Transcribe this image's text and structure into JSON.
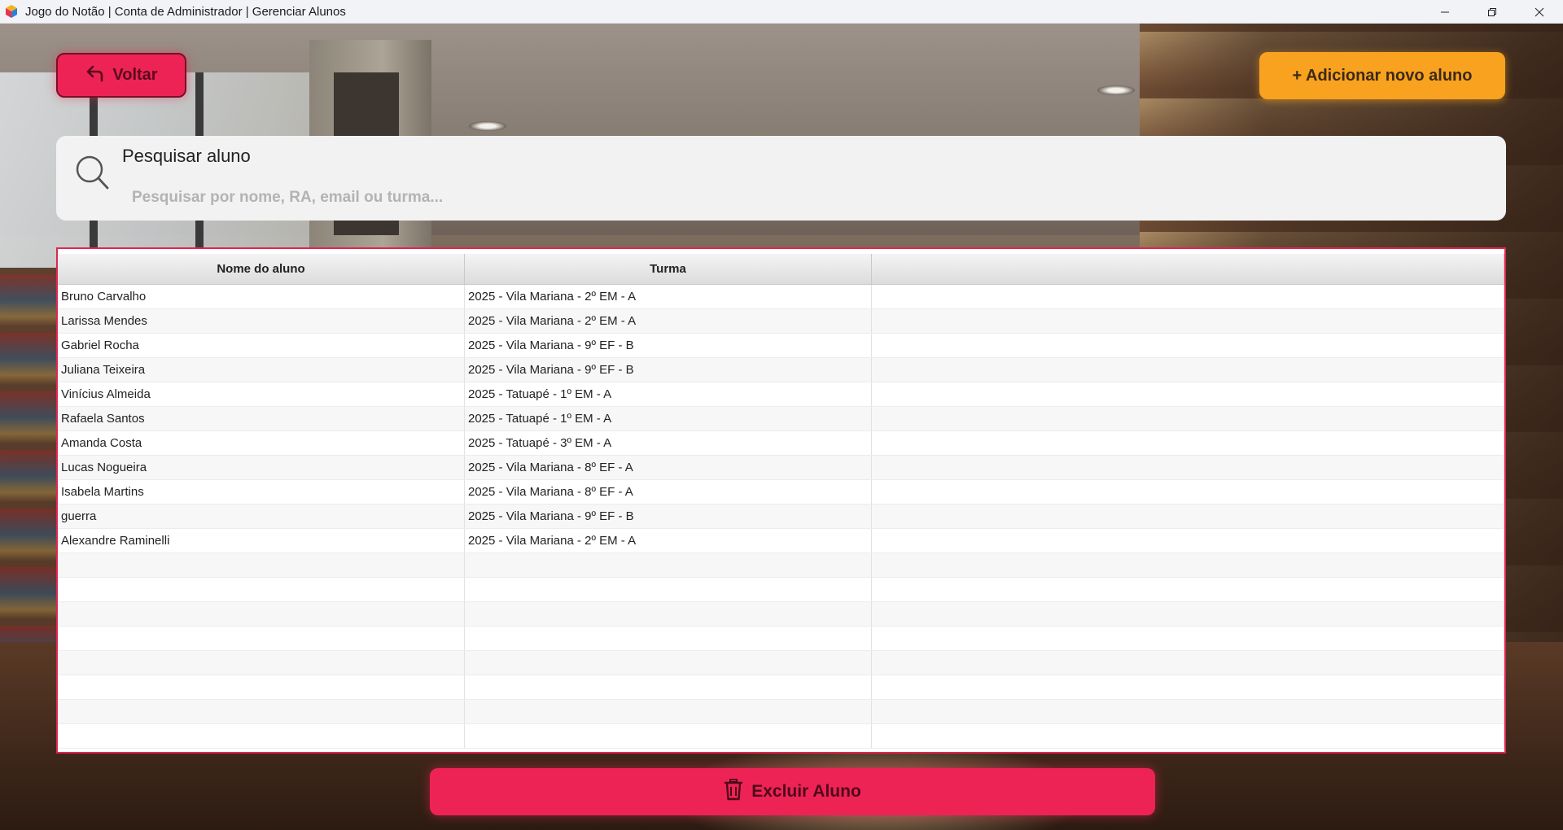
{
  "window": {
    "title": "Jogo do Notão | Conta de Administrador | Gerenciar Alunos",
    "controls": [
      "minimize-icon",
      "restore-icon",
      "close-icon"
    ]
  },
  "toolbar": {
    "back_label": "Voltar",
    "add_label": "+ Adicionar novo aluno"
  },
  "search": {
    "label": "Pesquisar aluno",
    "placeholder": "Pesquisar por nome, RA, email ou turma...",
    "value": ""
  },
  "table": {
    "columns": [
      "Nome do aluno",
      "Turma",
      ""
    ],
    "rows": [
      {
        "name": "Bruno Carvalho",
        "class": "2025 - Vila Mariana - 2º EM - A"
      },
      {
        "name": "Larissa Mendes",
        "class": "2025 - Vila Mariana - 2º EM - A"
      },
      {
        "name": "Gabriel Rocha",
        "class": "2025 - Vila Mariana - 9º EF - B"
      },
      {
        "name": "Juliana Teixeira",
        "class": "2025 - Vila Mariana - 9º EF - B"
      },
      {
        "name": "Vinícius Almeida",
        "class": "2025 - Tatuapé - 1º EM - A"
      },
      {
        "name": "Rafaela Santos",
        "class": "2025 - Tatuapé - 1º EM - A"
      },
      {
        "name": "Amanda Costa",
        "class": "2025 - Tatuapé - 3º EM - A"
      },
      {
        "name": "Lucas Nogueira",
        "class": "2025 - Vila Mariana - 8º EF - A"
      },
      {
        "name": "Isabela Martins",
        "class": "2025 - Vila Mariana - 8º EF - A"
      },
      {
        "name": "guerra",
        "class": "2025 - Vila Mariana - 9º EF - B"
      },
      {
        "name": "Alexandre Raminelli",
        "class": "2025 - Vila Mariana - 2º EM - A"
      }
    ]
  },
  "actions": {
    "delete_label": "Excluir Aluno"
  },
  "colors": {
    "accent_red": "#ee2355",
    "accent_orange": "#f9a21f",
    "table_border": "#e02650"
  }
}
